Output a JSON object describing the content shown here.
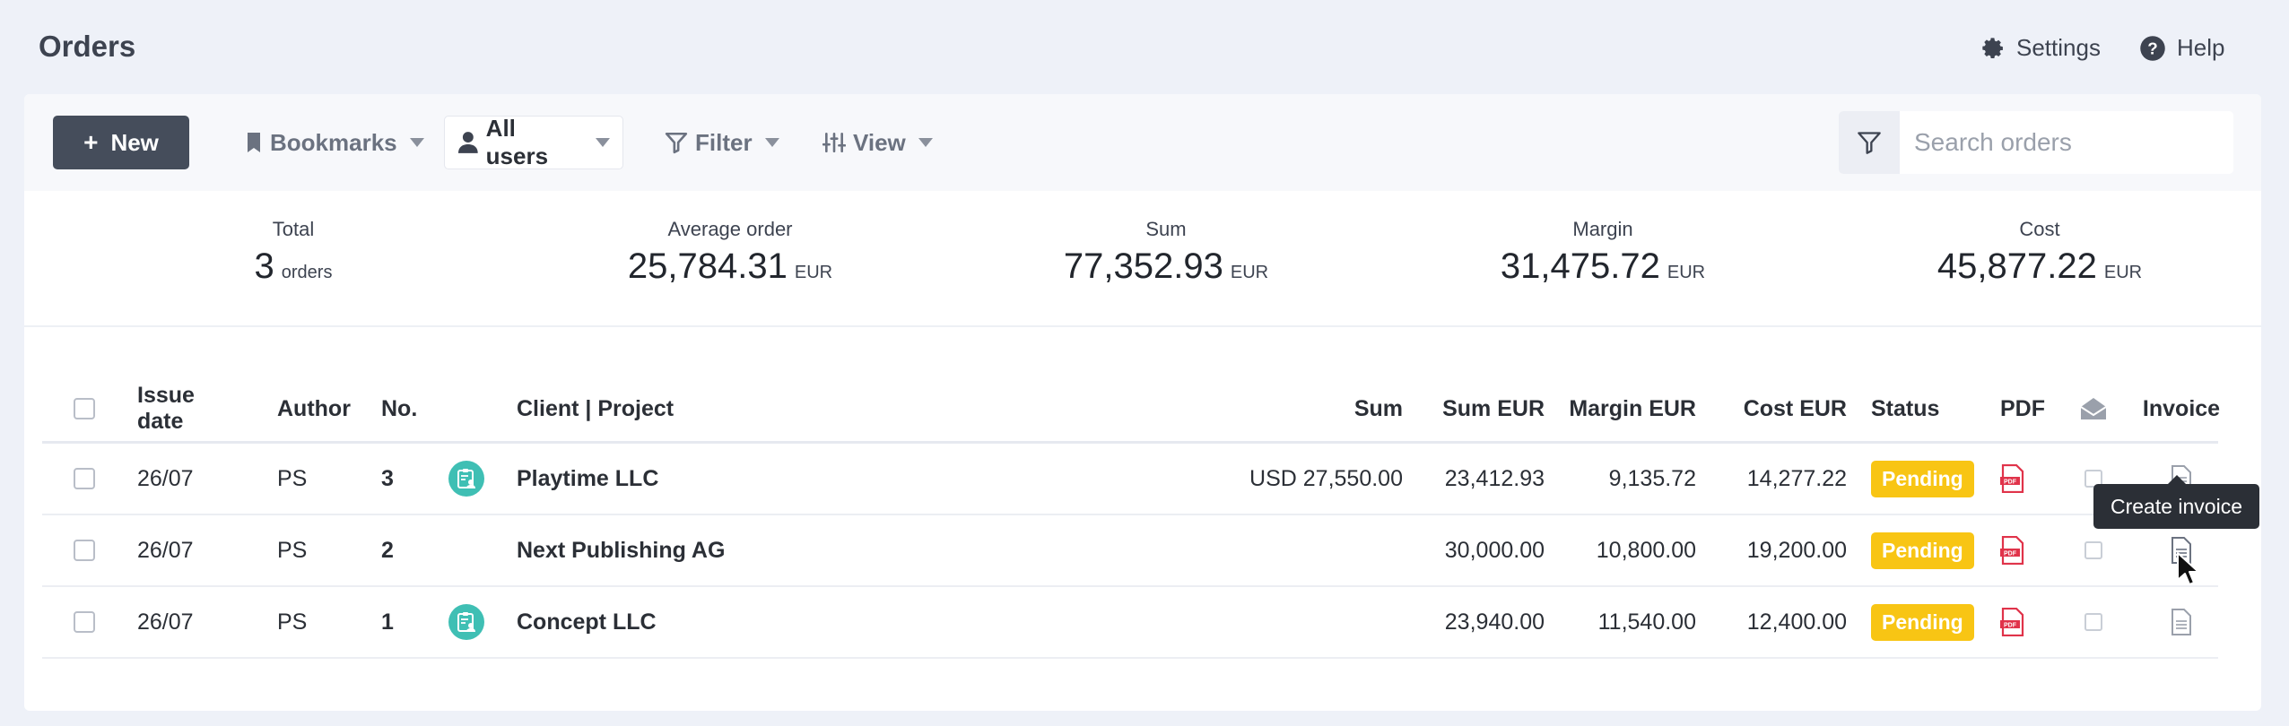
{
  "header": {
    "title": "Orders",
    "settings_label": "Settings",
    "help_label": "Help"
  },
  "toolbar": {
    "new_label": "New",
    "bookmarks_label": "Bookmarks",
    "users_label": "All users",
    "filter_label": "Filter",
    "view_label": "View",
    "search_placeholder": "Search orders"
  },
  "stats": {
    "total": {
      "label": "Total",
      "value": "3",
      "unit": "orders"
    },
    "average": {
      "label": "Average order",
      "value": "25,784.31",
      "unit": "EUR"
    },
    "sum": {
      "label": "Sum",
      "value": "77,352.93",
      "unit": "EUR"
    },
    "margin": {
      "label": "Margin",
      "value": "31,475.72",
      "unit": "EUR"
    },
    "cost": {
      "label": "Cost",
      "value": "45,877.22",
      "unit": "EUR"
    }
  },
  "table": {
    "headers": {
      "issue_date": "Issue date",
      "author": "Author",
      "no": "No.",
      "client": "Client | Project",
      "sum": "Sum",
      "sum_eur": "Sum EUR",
      "margin_eur": "Margin EUR",
      "cost_eur": "Cost EUR",
      "status": "Status",
      "pdf": "PDF",
      "invoice": "Invoice"
    },
    "rows": [
      {
        "date": "26/07",
        "author": "PS",
        "no": "3",
        "client": "Playtime LLC",
        "sum": "USD 27,550.00",
        "sum_eur": "23,412.93",
        "margin": "9,135.72",
        "cost": "14,277.22",
        "status": "Pending"
      },
      {
        "date": "26/07",
        "author": "PS",
        "no": "2",
        "client": "Next Publishing AG",
        "sum": "",
        "sum_eur": "30,000.00",
        "margin": "10,800.00",
        "cost": "19,200.00",
        "status": "Pending"
      },
      {
        "date": "26/07",
        "author": "PS",
        "no": "1",
        "client": "Concept LLC",
        "sum": "",
        "sum_eur": "23,940.00",
        "margin": "11,540.00",
        "cost": "12,400.00",
        "status": "Pending"
      }
    ]
  },
  "tooltip": {
    "text": "Create invoice"
  },
  "colors": {
    "accent": "#454d5b",
    "pending": "#f8c514",
    "project_icon": "#3fbfb4",
    "pdf": "#e0334a"
  }
}
